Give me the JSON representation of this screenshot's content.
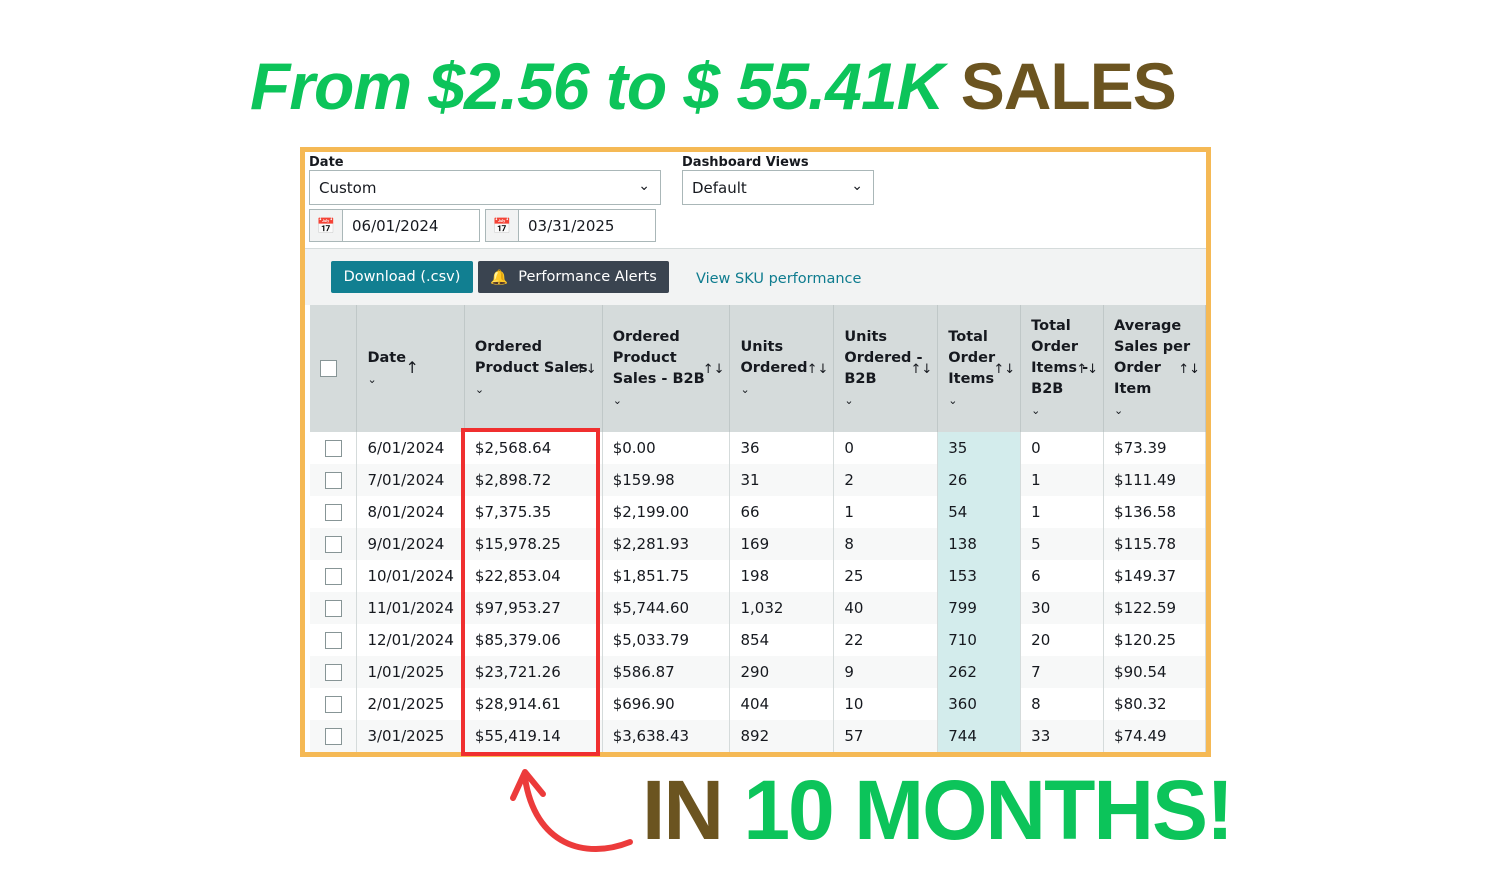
{
  "headline": {
    "part1": "From $2.56 to $ 55.41K",
    "part2": "SALES"
  },
  "filters": {
    "date_label": "Date",
    "date_value": "Custom",
    "views_label": "Dashboard Views",
    "views_value": "Default",
    "start_date": "06/01/2024",
    "end_date": "03/31/2025"
  },
  "toolbar": {
    "download": "Download (.csv)",
    "alerts": "Performance Alerts",
    "sku_link": "View SKU performance"
  },
  "table": {
    "headers": [
      "Date",
      "Ordered Product Sales",
      "Ordered Product Sales - B2B",
      "Units Ordered",
      "Units Ordered - B2B",
      "Total Order Items",
      "Total Order Items - B2B",
      "Average Sales per Order Item"
    ],
    "rows": [
      [
        "6/01/2024",
        "$2,568.64",
        "$0.00",
        "36",
        "0",
        "35",
        "0",
        "$73.39"
      ],
      [
        "7/01/2024",
        "$2,898.72",
        "$159.98",
        "31",
        "2",
        "26",
        "1",
        "$111.49"
      ],
      [
        "8/01/2024",
        "$7,375.35",
        "$2,199.00",
        "66",
        "1",
        "54",
        "1",
        "$136.58"
      ],
      [
        "9/01/2024",
        "$15,978.25",
        "$2,281.93",
        "169",
        "8",
        "138",
        "5",
        "$115.78"
      ],
      [
        "10/01/2024",
        "$22,853.04",
        "$1,851.75",
        "198",
        "25",
        "153",
        "6",
        "$149.37"
      ],
      [
        "11/01/2024",
        "$97,953.27",
        "$5,744.60",
        "1,032",
        "40",
        "799",
        "30",
        "$122.59"
      ],
      [
        "12/01/2024",
        "$85,379.06",
        "$5,033.79",
        "854",
        "22",
        "710",
        "20",
        "$120.25"
      ],
      [
        "1/01/2025",
        "$23,721.26",
        "$586.87",
        "290",
        "9",
        "262",
        "7",
        "$90.54"
      ],
      [
        "2/01/2025",
        "$28,914.61",
        "$696.90",
        "404",
        "10",
        "360",
        "8",
        "$80.32"
      ],
      [
        "3/01/2025",
        "$55,419.14",
        "$3,638.43",
        "892",
        "57",
        "744",
        "33",
        "$74.49"
      ]
    ]
  },
  "footer": {
    "part1": "IN",
    "part2": "10 MONTHS!"
  }
}
